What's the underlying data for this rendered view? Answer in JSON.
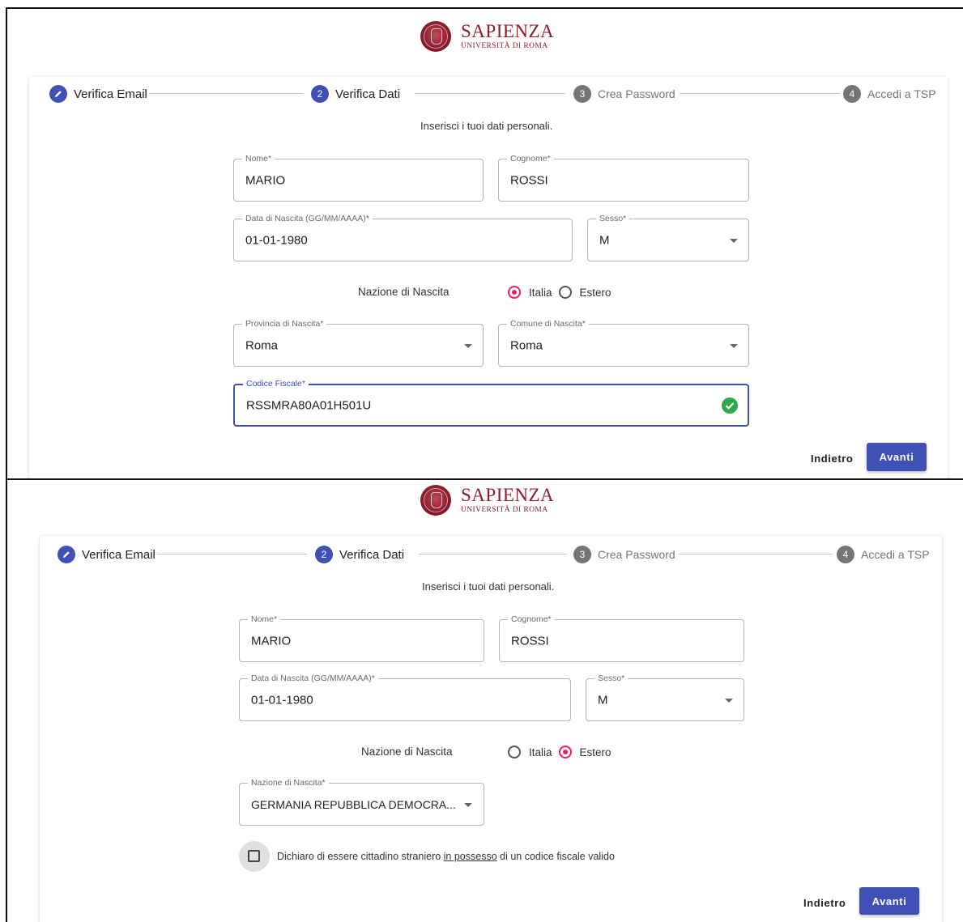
{
  "logo": {
    "name": "SAPIENZA",
    "sub": "UNIVERSITÀ DI ROMA"
  },
  "steps": [
    {
      "num": "✎",
      "label": "Verifica Email"
    },
    {
      "num": "2",
      "label": "Verifica Dati"
    },
    {
      "num": "3",
      "label": "Crea Password"
    },
    {
      "num": "4",
      "label": "Accedi a TSP"
    }
  ],
  "subtitle": "Inserisci i tuoi dati personali.",
  "labels": {
    "nome": "Nome*",
    "cognome": "Cognome*",
    "data_nascita": "Data di Nascita (GG/MM/AAAA)*",
    "sesso": "Sesso*",
    "nazione_nascita": "Nazione di Nascita",
    "italia": "Italia",
    "estero": "Estero",
    "provincia": "Provincia di Nascita*",
    "comune": "Comune di Nascita*",
    "codice_fiscale": "Codice Fiscale*",
    "nazione_field": "Nazione di Nascita*"
  },
  "values": {
    "nome": "MARIO",
    "cognome": "ROSSI",
    "data_nascita": "01-01-1980",
    "sesso": "M",
    "provincia": "Roma",
    "comune": "Roma",
    "codice_fiscale": "RSSMRA80A01H501U",
    "nazione": "GERMANIA REPUBBLICA DEMOCRA..."
  },
  "declaration": {
    "before": "Dichiaro di essere cittadino straniero ",
    "link": "in possesso",
    "after": " di un codice fiscale valido"
  },
  "buttons": {
    "back": "Indietro",
    "next": "Avanti"
  },
  "colors": {
    "primary": "#3f51b5",
    "radio": "#e91e63",
    "success": "#2ea84b",
    "brand": "#8c1d2c"
  }
}
